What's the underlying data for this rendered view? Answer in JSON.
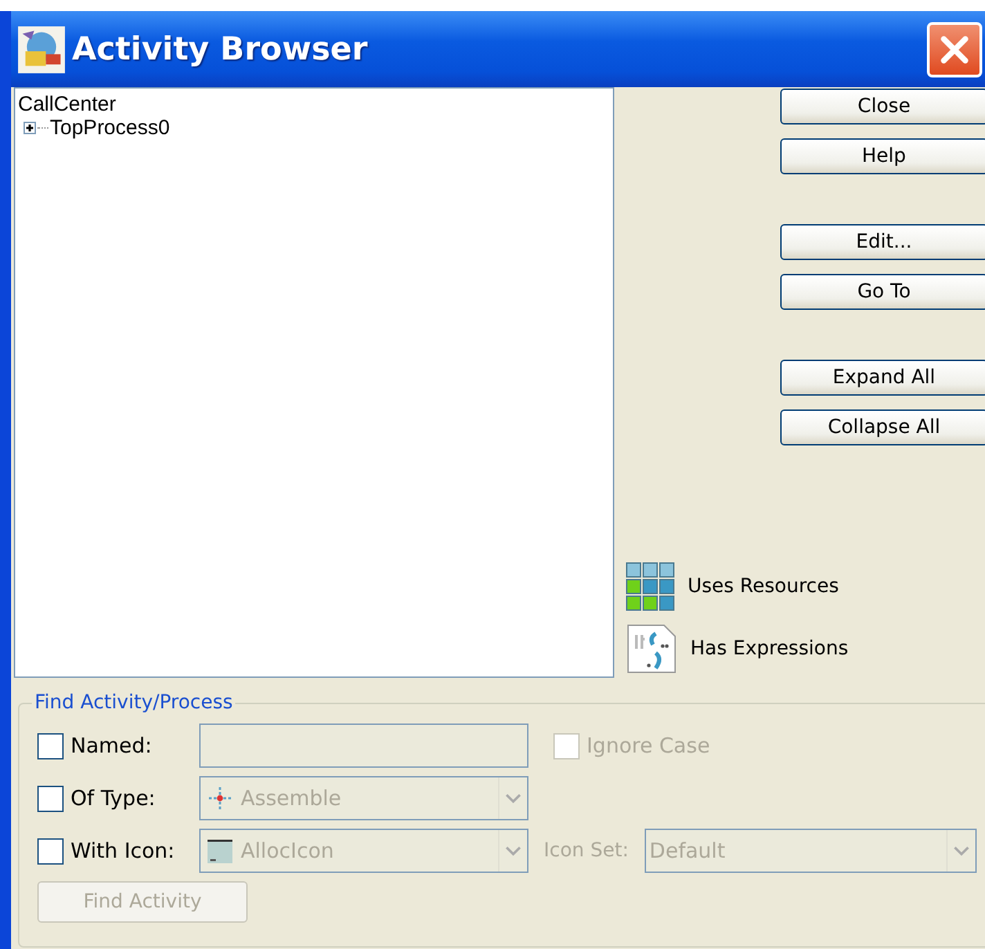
{
  "window": {
    "title": "Activity Browser"
  },
  "tree": {
    "label": "CallCenter",
    "children": [
      {
        "label": "TopProcess0",
        "expanded": false
      }
    ]
  },
  "button_groups": [
    [
      {
        "label": "Close"
      },
      {
        "label": "Help"
      }
    ],
    [
      {
        "label": "Edit..."
      },
      {
        "label": "Go To"
      }
    ],
    [
      {
        "label": "Expand All"
      },
      {
        "label": "Collapse All"
      }
    ]
  ],
  "legend": [
    {
      "kind": "resources",
      "label": "Uses Resources"
    },
    {
      "kind": "expressions",
      "label": "Has Expressions"
    }
  ],
  "find": {
    "title": "Find Activity/Process",
    "rows": [
      {
        "kind": "text",
        "label": "Named:",
        "checked": false,
        "disabled": true,
        "option": {
          "label": "Ignore Case",
          "checked": false,
          "disabled": true
        }
      },
      {
        "kind": "type",
        "label": "Of Type:",
        "checked": false,
        "disabled": true,
        "value": "Assemble"
      },
      {
        "kind": "icon",
        "label": "With Icon:",
        "checked": false,
        "disabled": true,
        "value": "AllocIcon",
        "extra": {
          "label": "Icon Set:",
          "value": "Default",
          "disabled": true
        }
      }
    ],
    "button": {
      "label": "Find Activity",
      "disabled": true
    }
  }
}
